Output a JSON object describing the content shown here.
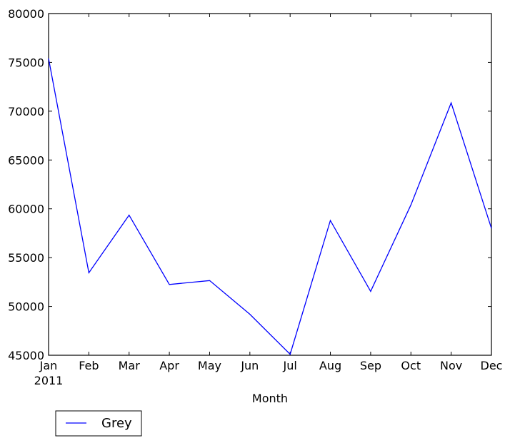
{
  "chart_data": {
    "type": "line",
    "title": "",
    "xlabel": "Month",
    "ylabel": "",
    "x": [
      "Jan",
      "Feb",
      "Mar",
      "Apr",
      "May",
      "Jun",
      "Jul",
      "Aug",
      "Sep",
      "Oct",
      "Nov",
      "Dec"
    ],
    "x_tick_labels": [
      "Jan",
      "Feb",
      "Mar",
      "Apr",
      "May",
      "Jun",
      "Jul",
      "Aug",
      "Sep",
      "Oct",
      "Nov",
      "Dec"
    ],
    "x_year_label": "2011",
    "y_ticks": [
      45000,
      50000,
      55000,
      60000,
      65000,
      70000,
      75000,
      80000
    ],
    "y_tick_labels": [
      "45000",
      "50000",
      "55000",
      "60000",
      "65000",
      "70000",
      "75000",
      "80000"
    ],
    "ylim": [
      45000,
      80000
    ],
    "grid": false,
    "legend": {
      "placement": "below-left",
      "entries": [
        "Grey"
      ]
    },
    "series": [
      {
        "name": "Grey",
        "color": "#0000ff",
        "values": [
          75400,
          53450,
          59350,
          52250,
          52650,
          49200,
          45100,
          58800,
          51550,
          60400,
          70850,
          58000
        ]
      }
    ]
  }
}
